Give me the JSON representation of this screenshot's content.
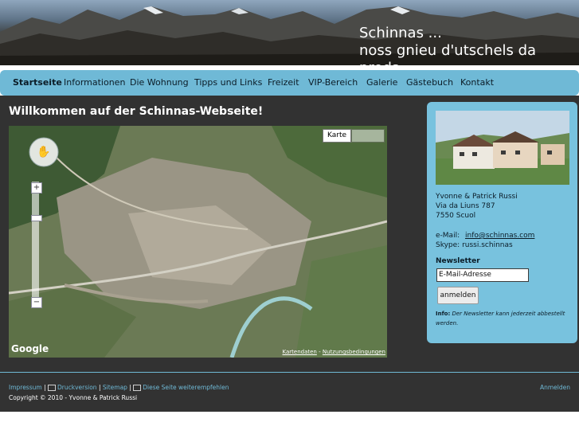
{
  "header": {
    "tagline_line1": "Schinnas ...",
    "tagline_line2": "noss gnieu d'utschels da preda"
  },
  "nav": {
    "items": [
      {
        "label": "Startseite",
        "active": true
      },
      {
        "label": "Informationen"
      },
      {
        "label": "Die Wohnung"
      },
      {
        "label": "Tipps und Links"
      },
      {
        "label": "Freizeit"
      },
      {
        "label": "VIP-Bereich"
      },
      {
        "label": "Galerie"
      },
      {
        "label": "Gästebuch"
      },
      {
        "label": "Kontakt"
      }
    ]
  },
  "main": {
    "title": "Willkommen auf der Schinnas-Webseite!",
    "map": {
      "type_button": "Karte",
      "logo": "Google",
      "footer_link1": "Kartendaten",
      "footer_sep": "-",
      "footer_link2": "Nutzungsbedingungen"
    }
  },
  "sidebar": {
    "name": "Yvonne & Patrick Russi",
    "street": "Via da Liuns 787",
    "city": "7550 Scuol",
    "email_label": "e-Mail:",
    "email_value": "info@schinnas.com",
    "skype_label": "Skype:",
    "skype_value": "russi.schinnas",
    "newsletter_heading": "Newsletter",
    "newsletter_input": "E-Mail-Adresse",
    "newsletter_button": "anmelden",
    "info_label": "Info:",
    "info_text": "Der Newsletter kann jederzeit abbestellt werden."
  },
  "footer": {
    "impressum": "Impressum",
    "sep": "|",
    "druckversion": "Druckversion",
    "sitemap": "Sitemap",
    "recommend": "Diese Seite weiterempfehlen",
    "copyright": "Copyright © 2010 - Yvonne & Patrick Russi",
    "login": "Anmelden"
  },
  "colors": {
    "nav_bg": "#6fb9d6",
    "sidebar_bg": "#78c2de",
    "content_bg": "#323232",
    "link": "#6fb9d6"
  }
}
